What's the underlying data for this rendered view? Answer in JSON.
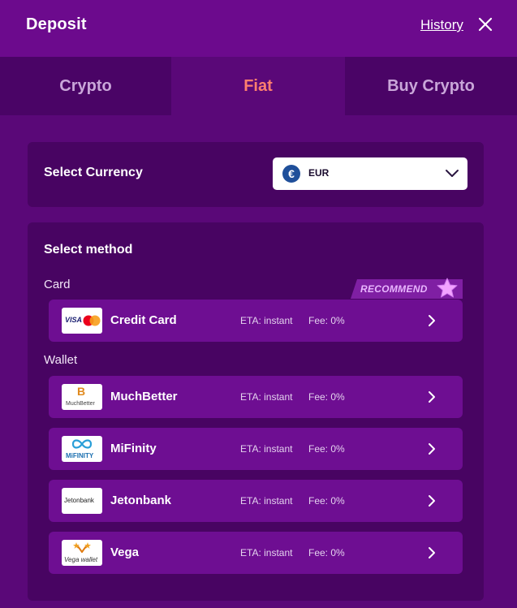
{
  "header": {
    "title": "Deposit",
    "history_label": "History"
  },
  "tabs": [
    {
      "label": "Crypto",
      "active": false
    },
    {
      "label": "Fiat",
      "active": true
    },
    {
      "label": "Buy Crypto",
      "active": false
    }
  ],
  "currency": {
    "label": "Select Currency",
    "selected": "EUR",
    "icon": "euro-icon"
  },
  "methods": {
    "title": "Select method",
    "recommend_label": "RECOMMEND",
    "card_group_label": "Card",
    "wallet_group_label": "Wallet",
    "card": [
      {
        "name": "Credit Card",
        "eta": "ETA: instant",
        "fee": "Fee: 0%",
        "logo_text": "VISA"
      }
    ],
    "wallet": [
      {
        "name": "MuchBetter",
        "eta": "ETA: instant",
        "fee": "Fee: 0%",
        "logo_text": "MuchBetter"
      },
      {
        "name": "MiFinity",
        "eta": "ETA: instant",
        "fee": "Fee: 0%",
        "logo_text": "MiFINITY"
      },
      {
        "name": "Jetonbank",
        "eta": "ETA: instant",
        "fee": "Fee: 0%",
        "logo_text": "Jetonbank"
      },
      {
        "name": "Vega",
        "eta": "ETA: instant",
        "fee": "Fee: 0%",
        "logo_text": "Vega wallet"
      }
    ]
  },
  "colors": {
    "background": "#5a0878",
    "header": "#6c0a8d",
    "panel": "#480462",
    "row": "#6e0e92",
    "active_tab_text": "#ff7f6e"
  }
}
